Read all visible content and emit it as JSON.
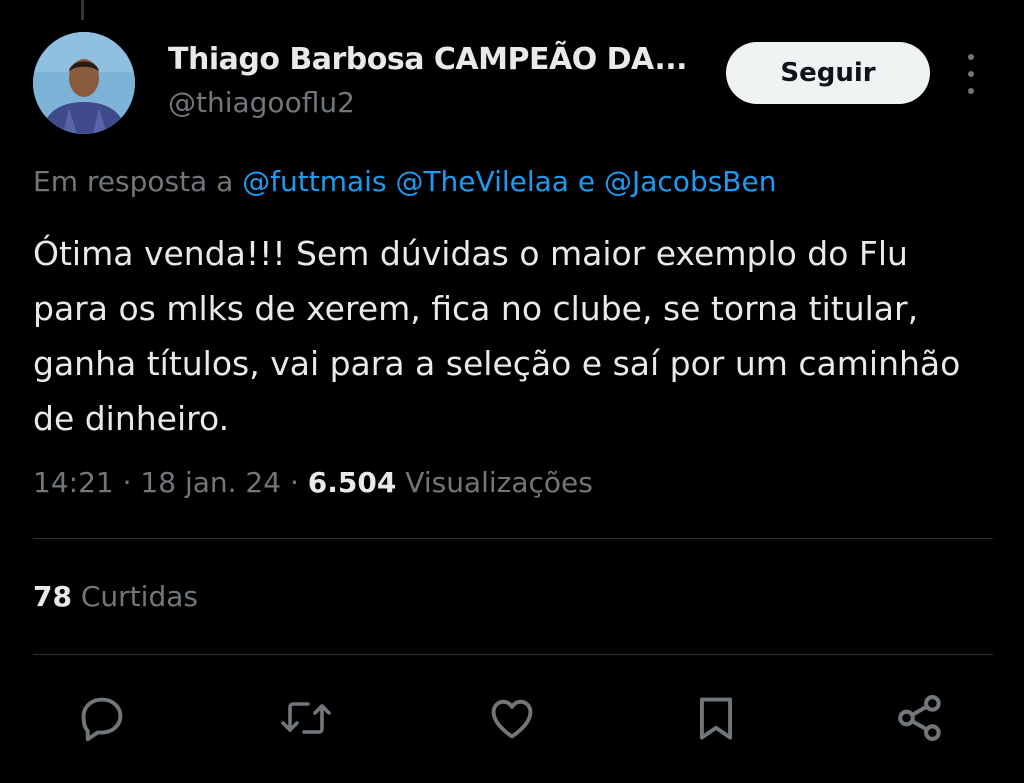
{
  "author": {
    "display_name": "Thiago Barbosa CAMPEÃO DA...",
    "handle": "@thiagooflu2"
  },
  "follow_label": "Seguir",
  "reply_context": {
    "prefix": "Em resposta a",
    "mention_1": "@futtmais",
    "mention_2": "@TheVilelaa",
    "conjunction": "e",
    "mention_3": "@JacobsBen"
  },
  "tweet": {
    "text": "Ótima venda!!! Sem dúvidas o maior exemplo do Flu para os mlks de xerem, fica no clube, se torna titular, ganha títulos, vai para a seleção e saí por um caminhão de dinheiro."
  },
  "meta": {
    "time": "14:21",
    "separator": "·",
    "date": "18 jan. 24",
    "views_count": "6.504",
    "views_label": "Visualizações"
  },
  "stats": {
    "likes_count": "78",
    "likes_label": "Curtidas"
  },
  "actions": [
    "reply-icon",
    "retweet-icon",
    "like-icon",
    "bookmark-icon",
    "share-icon"
  ],
  "colors": {
    "background": "#000000",
    "text": "#e7e9ea",
    "secondary": "#71767b",
    "link": "#1d9bf0",
    "button_bg": "#eff3f4"
  }
}
